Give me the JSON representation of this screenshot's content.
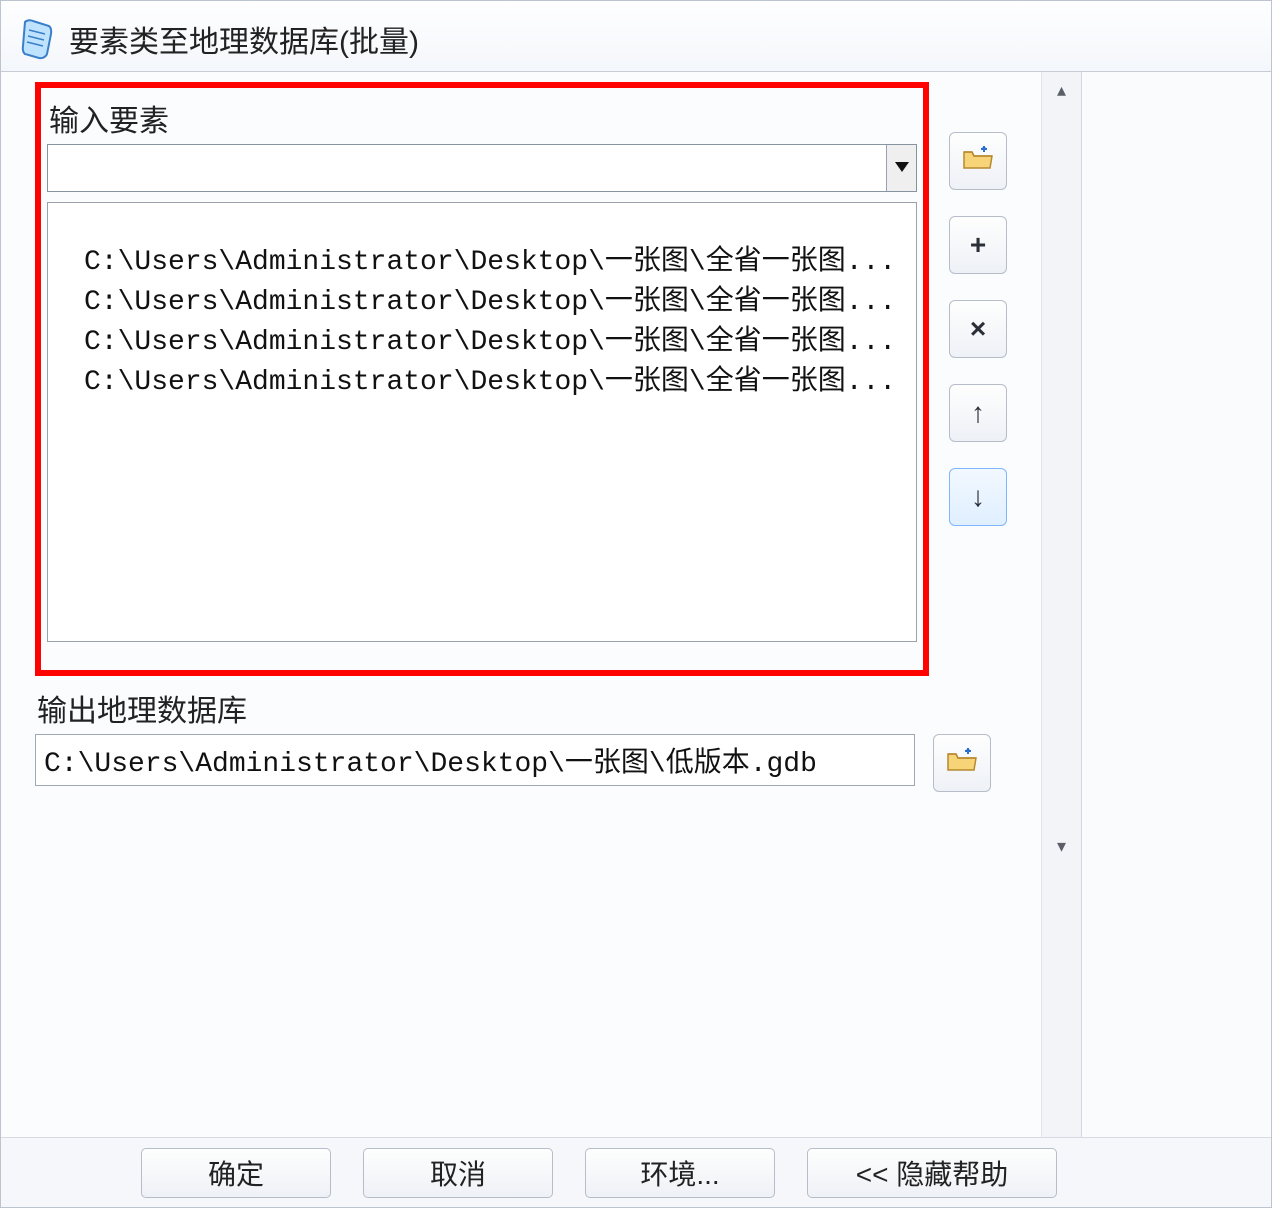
{
  "window": {
    "title": "要素类至地理数据库(批量)"
  },
  "input_section": {
    "label": "输入要素",
    "combo_value": "",
    "items": [
      "C:\\Users\\Administrator\\Desktop\\一张图\\全省一张图...",
      "C:\\Users\\Administrator\\Desktop\\一张图\\全省一张图...",
      "C:\\Users\\Administrator\\Desktop\\一张图\\全省一张图...",
      "C:\\Users\\Administrator\\Desktop\\一张图\\全省一张图..."
    ]
  },
  "output_section": {
    "label": "输出地理数据库",
    "value": "C:\\Users\\Administrator\\Desktop\\一张图\\低版本.gdb"
  },
  "side_buttons": {
    "browse": "📂",
    "add": "+",
    "remove": "×",
    "up": "↑",
    "down": "↓"
  },
  "footer": {
    "ok": "确定",
    "cancel": "取消",
    "env": "环境...",
    "hide_help": "<< 隐藏帮助"
  }
}
